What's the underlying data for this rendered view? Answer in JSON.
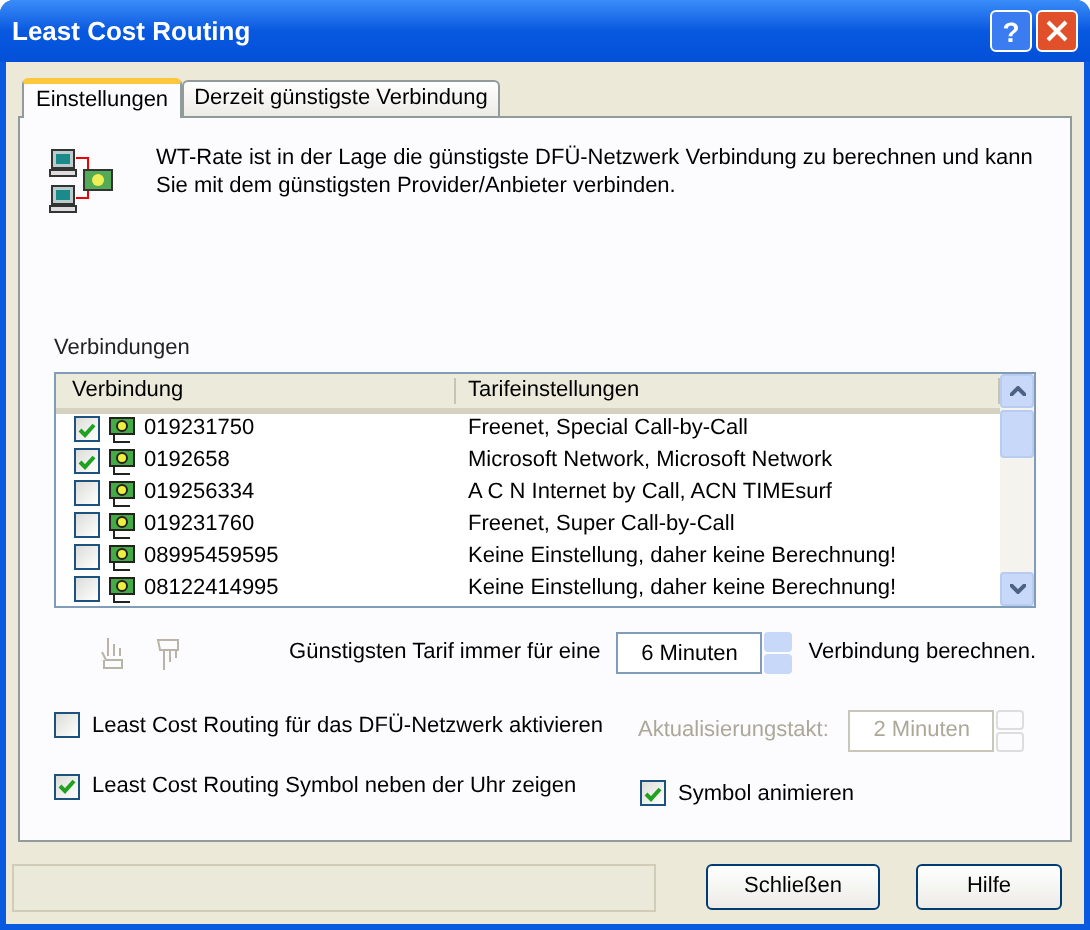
{
  "window": {
    "title": "Least Cost Routing",
    "help_label": "?"
  },
  "tabs": [
    {
      "label": "Einstellungen",
      "selected": true
    },
    {
      "label": "Derzeit günstigste Verbindung",
      "selected": false
    }
  ],
  "description": "WT-Rate ist in der Lage die günstigste DFÜ-Netzwerk Verbindung zu berechnen und kann Sie mit dem günstigsten Provider/Anbieter verbinden.",
  "connections": {
    "label": "Verbindungen",
    "columns": [
      "Verbindung",
      "Tarifeinstellungen"
    ],
    "rows": [
      {
        "checked": true,
        "number": "019231750",
        "tariff": "Freenet, Special Call-by-Call"
      },
      {
        "checked": true,
        "number": "0192658",
        "tariff": "Microsoft Network, Microsoft Network"
      },
      {
        "checked": false,
        "number": "019256334",
        "tariff": "A C N Internet by Call, ACN TIMEsurf"
      },
      {
        "checked": false,
        "number": "019231760",
        "tariff": "Freenet, Super Call-by-Call"
      },
      {
        "checked": false,
        "number": "08995459595",
        "tariff": "Keine Einstellung, daher keine Berechnung!"
      },
      {
        "checked": false,
        "number": "08122414995",
        "tariff": "Keine Einstellung, daher keine Berechnung!"
      }
    ]
  },
  "move_buttons": [
    {
      "disabled": true
    },
    {
      "disabled": true
    }
  ],
  "tariff_interval": {
    "prefix": "Günstigsten Tarif immer für eine",
    "value": "6 Minuten",
    "suffix": "Verbindung berechnen."
  },
  "options": [
    {
      "label": "Least Cost Routing für das DFÜ-Netzwerk aktivieren",
      "checked": false
    },
    {
      "label": "Least Cost Routing Symbol neben der Uhr zeigen",
      "checked": true
    }
  ],
  "update_interval": {
    "label": "Aktualisierungstakt:",
    "value": "2 Minuten",
    "disabled": true
  },
  "animate": {
    "label": "Symbol animieren",
    "checked": true
  },
  "buttons": [
    "Schließen",
    "Hilfe"
  ]
}
